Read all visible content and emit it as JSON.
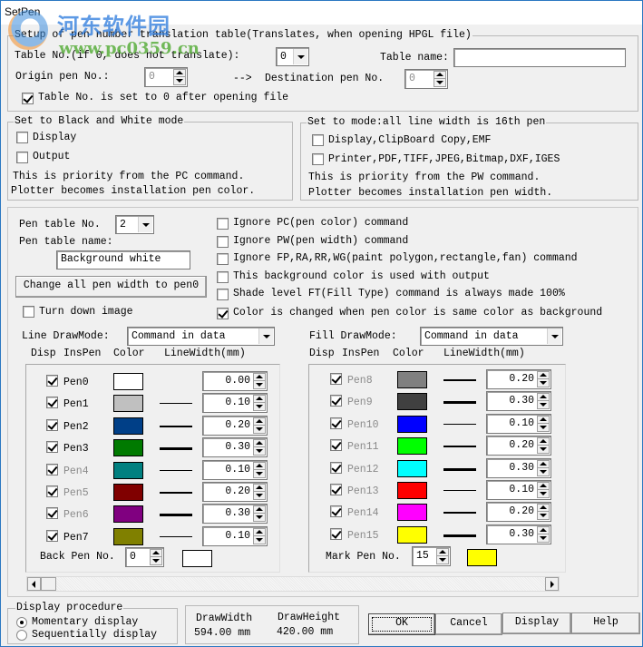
{
  "window": {
    "title": "SetPen",
    "watermark": {
      "cn": "河东软件园",
      "url": "www.pc0359.cn"
    }
  },
  "translation": {
    "group_label": "Setup of pen number translation table(Translates, when opening HPGL file)",
    "table_no_label": "Table No.(if 0, does not translate):",
    "table_no_value": "0",
    "table_name_label": "Table name:",
    "table_name_value": "",
    "origin_label": "Origin pen No.:",
    "origin_value": "0",
    "arrow": "-->",
    "dest_label": "Destination pen No.",
    "dest_value": "0",
    "reset_checkbox_label": "Table No. is set to 0 after opening file",
    "reset_checked": true
  },
  "bw_mode": {
    "group_label": "Set to Black and White mode",
    "display_label": "Display",
    "display_checked": false,
    "output_label": "Output",
    "output_checked": false,
    "note1": "This is priority from the PC command.",
    "note2": "Plotter becomes installation pen color."
  },
  "lw_mode": {
    "group_label": "Set to mode:all line width is 16th pen",
    "display_label": "Display,ClipBoard Copy,EMF",
    "display_checked": false,
    "printer_label": "Printer,PDF,TIFF,JPEG,Bitmap,DXF,IGES",
    "printer_checked": false,
    "note1": "This is priority from the PW command.",
    "note2": "Plotter becomes installation pen width."
  },
  "pen_table": {
    "no_label": "Pen table No.",
    "no_value": "2",
    "name_label": "Pen table name:",
    "name_value": "Background white",
    "change_all_button": "Change all pen width to pen0",
    "turn_down_label": "Turn down image",
    "turn_down_checked": false
  },
  "options": [
    {
      "label": "Ignore PC(pen color) command",
      "checked": false
    },
    {
      "label": "Ignore PW(pen width) command",
      "checked": false
    },
    {
      "label": "Ignore FP,RA,RR,WG(paint polygon,rectangle,fan) command",
      "checked": false
    },
    {
      "label": "This background color is used with output",
      "checked": false
    },
    {
      "label": "Shade level FT(Fill Type) command is always made 100%",
      "checked": false
    },
    {
      "label": "Color is changed when pen color is same color as background",
      "checked": true
    }
  ],
  "line_draw": {
    "label": "Line DrawMode:",
    "value": "Command in data",
    "headers": {
      "disp": "Disp",
      "inspen": "InsPen",
      "color": "Color",
      "linewidth": "LineWidth(mm)"
    },
    "pens": [
      {
        "name": "Pen0",
        "checked": true,
        "enabled": true,
        "color": "#ffffff",
        "width": "0.00"
      },
      {
        "name": "Pen1",
        "checked": true,
        "enabled": true,
        "color": "#c0c0c0",
        "width": "0.10"
      },
      {
        "name": "Pen2",
        "checked": true,
        "enabled": true,
        "color": "#003f87",
        "width": "0.20"
      },
      {
        "name": "Pen3",
        "checked": true,
        "enabled": true,
        "color": "#007a00",
        "width": "0.30"
      },
      {
        "name": "Pen4",
        "checked": true,
        "enabled": false,
        "color": "#008080",
        "width": "0.10"
      },
      {
        "name": "Pen5",
        "checked": true,
        "enabled": false,
        "color": "#800000",
        "width": "0.20"
      },
      {
        "name": "Pen6",
        "checked": true,
        "enabled": false,
        "color": "#800080",
        "width": "0.30"
      },
      {
        "name": "Pen7",
        "checked": true,
        "enabled": true,
        "color": "#808000",
        "width": "0.10"
      }
    ],
    "back_pen_label": "Back Pen No.",
    "back_pen_value": "0",
    "back_pen_color": "#ffffff"
  },
  "fill_draw": {
    "label": "Fill DrawMode:",
    "value": "Command in data",
    "headers": {
      "disp": "Disp",
      "inspen": "InsPen",
      "color": "Color",
      "linewidth": "LineWidth(mm)"
    },
    "pens": [
      {
        "name": "Pen8",
        "checked": true,
        "enabled": false,
        "color": "#808080",
        "width": "0.20"
      },
      {
        "name": "Pen9",
        "checked": true,
        "enabled": false,
        "color": "#404040",
        "width": "0.30"
      },
      {
        "name": "Pen10",
        "checked": true,
        "enabled": false,
        "color": "#0000ff",
        "width": "0.10"
      },
      {
        "name": "Pen11",
        "checked": true,
        "enabled": false,
        "color": "#00ff00",
        "width": "0.20"
      },
      {
        "name": "Pen12",
        "checked": true,
        "enabled": false,
        "color": "#00ffff",
        "width": "0.30"
      },
      {
        "name": "Pen13",
        "checked": true,
        "enabled": false,
        "color": "#ff0000",
        "width": "0.10"
      },
      {
        "name": "Pen14",
        "checked": true,
        "enabled": false,
        "color": "#ff00ff",
        "width": "0.20"
      },
      {
        "name": "Pen15",
        "checked": true,
        "enabled": false,
        "color": "#ffff00",
        "width": "0.30"
      }
    ],
    "mark_pen_label": "Mark Pen No.",
    "mark_pen_value": "15",
    "mark_pen_color": "#ffff00"
  },
  "display_procedure": {
    "group_label": "Display procedure",
    "options": [
      {
        "label": "Momentary display",
        "selected": true
      },
      {
        "label": "Sequentially display",
        "selected": false
      }
    ]
  },
  "draw_size": {
    "width_label": "DrawWidth",
    "width_value": "594.00 mm",
    "height_label": "DrawHeight",
    "height_value": "420.00 mm"
  },
  "buttons": {
    "ok": "OK",
    "cancel": "Cancel",
    "display": "Display",
    "help": "Help"
  }
}
